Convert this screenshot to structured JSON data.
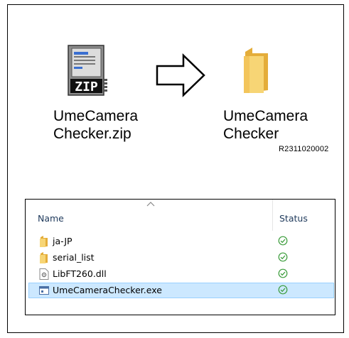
{
  "left_item": {
    "label_line1": "UmeCamera",
    "label_line2": "Checker.zip",
    "icon": "zip-archive-icon",
    "icon_text": "ZIP"
  },
  "right_item": {
    "label_line1": "UmeCamera",
    "label_line2": "Checker",
    "icon": "folder-icon"
  },
  "arrow": {
    "icon": "arrow-right-icon"
  },
  "reference_code": "R2311020002",
  "explorer": {
    "columns": {
      "name": "Name",
      "status": "Status"
    },
    "rows": [
      {
        "name": "ja-JP",
        "icon": "folder-icon",
        "status": "synced-check-icon",
        "selected": false
      },
      {
        "name": "serial_list",
        "icon": "folder-icon",
        "status": "synced-check-icon",
        "selected": false
      },
      {
        "name": "LibFT260.dll",
        "icon": "dll-file-icon",
        "status": "synced-check-icon",
        "selected": false
      },
      {
        "name": "UmeCameraChecker.exe",
        "icon": "exe-file-icon",
        "status": "synced-check-icon",
        "selected": true
      }
    ]
  },
  "colors": {
    "folder": "#f0c24b",
    "selection_bg": "#cce8ff",
    "selection_border": "#99d1ff",
    "status_ok": "#3c9d3c"
  }
}
